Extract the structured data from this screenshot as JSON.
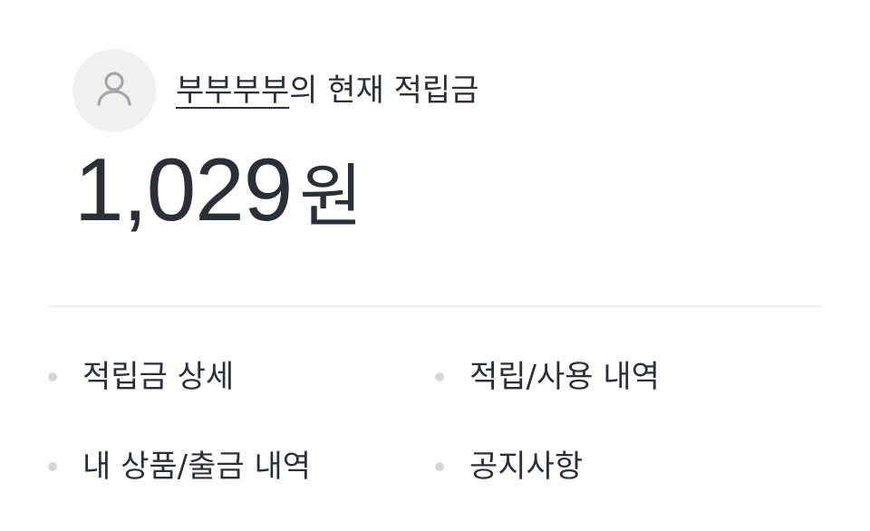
{
  "header": {
    "username": "부부부부",
    "title_suffix": "의 현재 적립금",
    "avatar_icon": "user-icon"
  },
  "balance": {
    "amount": "1,029",
    "unit": "원"
  },
  "menu": {
    "items": [
      {
        "label": "적립금 상세"
      },
      {
        "label": "적립/사용 내역"
      },
      {
        "label": "내 상품/출금 내역"
      },
      {
        "label": "공지사항"
      }
    ]
  },
  "colors": {
    "text": "#2b2f36",
    "avatar_bg": "#f0f0f1",
    "icon": "#a6a6aa",
    "bullet": "#d6d6d9",
    "divider": "#ececee"
  }
}
